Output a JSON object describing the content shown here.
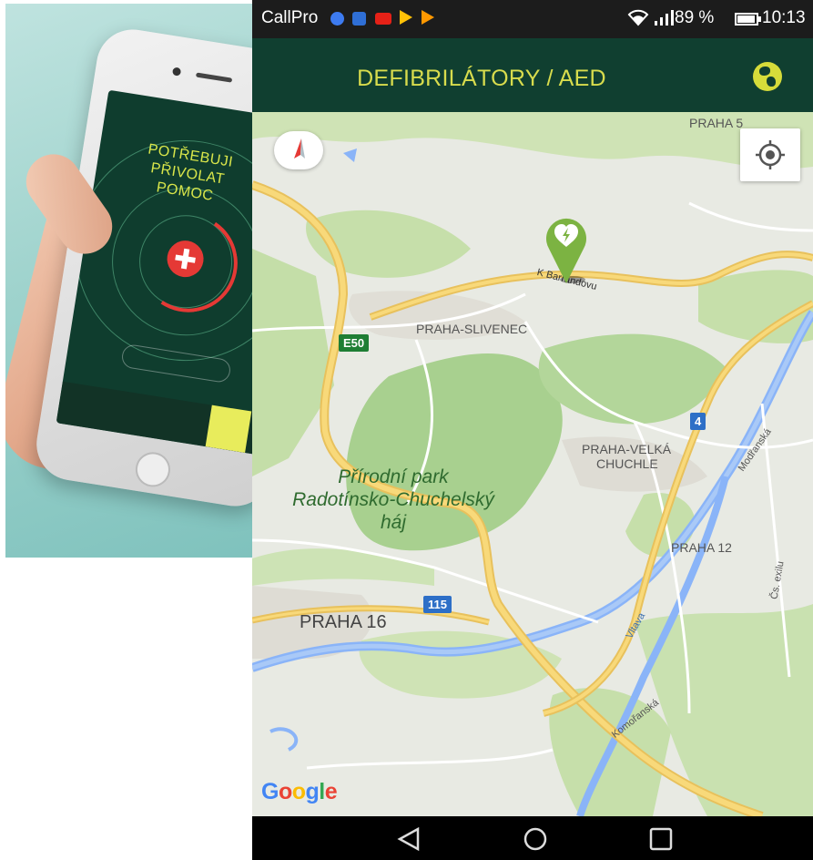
{
  "promo_phone": {
    "headline_lines": [
      "POTŘEBUJI",
      "PŘIVOLAT",
      "POMOC"
    ]
  },
  "status_bar": {
    "carrier": "CallPro",
    "battery": "89 %",
    "time": "10:13"
  },
  "app_bar": {
    "title": "DEFIBRILÁTORY / AED"
  },
  "map": {
    "labels": {
      "praha5": "PRAHA 5",
      "slivenec": "PRAHA-SLIVENEC",
      "velka_chuchle_1": "PRAHA-VELKÁ",
      "velka_chuchle_2": "CHUCHLE",
      "praha12": "PRAHA 12",
      "praha16": "PRAHA 16",
      "park_1": "Přírodní park",
      "park_2": "Radotínsko-Chuchelský",
      "park_3": "háj",
      "street_barrandovu": "K Barrandovu",
      "street_modranska": "Modřanská",
      "street_komoranska": "Komořanská",
      "street_exilu": "Čs. exilu",
      "river_vltava": "Vltava",
      "road_e50": "E50",
      "road_4": "4",
      "road_115": "115"
    },
    "google": [
      "G",
      "o",
      "o",
      "g",
      "l",
      "e"
    ]
  },
  "colors": {
    "app_bar": "#103f30",
    "title": "#d8dc4d",
    "aed_marker": "#7cb342"
  }
}
